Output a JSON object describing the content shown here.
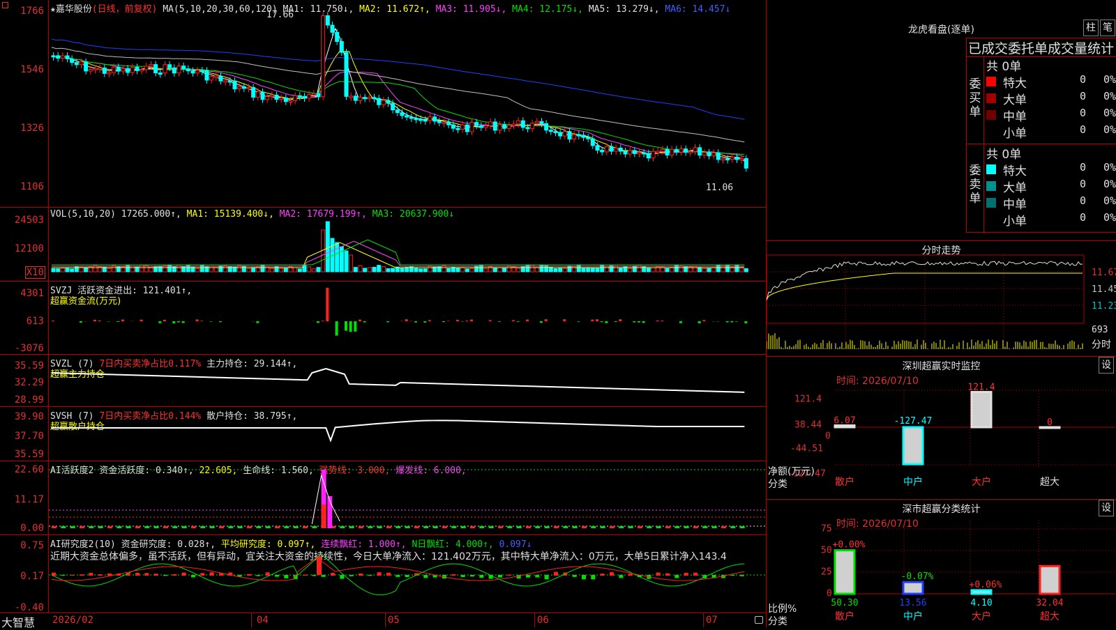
{
  "main": {
    "y_ticks": [
      "1766",
      "1546",
      "1326",
      "1106"
    ],
    "title_star": "★",
    "stock_name": "嘉华股份",
    "period": "(日线，前复权)",
    "ma_label": "MA(5,10,20,30,60,120)",
    "ma1": "MA1: 11.750↓,",
    "ma2": "MA2: 11.672↑,",
    "ma3": "MA3: 11.905↓,",
    "ma4": "MA4: 12.175↓,",
    "ma5": "MA5: 13.279↓,",
    "ma6": "MA6: 14.457↓",
    "high_mark": "17.66",
    "low_mark": "11.06"
  },
  "vol": {
    "y_ticks": [
      "24503",
      "12100"
    ],
    "unit": "X10",
    "label": "VOL(5,10,20)",
    "value": "17265.000↑,",
    "ma1": "MA1: 15139.400↓,",
    "ma2": "MA2: 17679.199↑,",
    "ma3": "MA3: 20637.900↓"
  },
  "svzj": {
    "y_ticks": [
      "4301",
      "613",
      "-3076"
    ],
    "line1": "SVZJ  活跃资金进出: 121.401↑,",
    "line2": "超赢资金流(万元)"
  },
  "svzl": {
    "y_ticks": [
      "35.59",
      "32.29",
      "28.99"
    ],
    "name": "SVZL (7)",
    "ratio": "7日内买卖净占比0.117%",
    "hold": "主力持仓: 29.144↑,",
    "line2": "超赢主力持仓"
  },
  "svsh": {
    "y_ticks": [
      "39.90",
      "37.70",
      "35.59"
    ],
    "name": "SVSH (7)",
    "ratio": "7日内买卖净占比0.144%",
    "hold": "散户持仓: 38.795↑,",
    "line2": "超赢散户持仓"
  },
  "ai1": {
    "y_ticks": [
      "22.60",
      "11.17",
      "0.00"
    ],
    "name": "AI活跃度2",
    "v1": "资金活跃度: 0.340↑,",
    "v2": "22.605,",
    "v3": "生命线: 1.560,",
    "v4": "强势线: 3.000,",
    "v5": "爆发线: 6.000,"
  },
  "ai2": {
    "y_ticks": [
      "0.75",
      "0.17",
      "-0.40"
    ],
    "name": "AI研究度2(10)",
    "v1": "资金研究度: 0.028↑,",
    "v2": "平均研究度: 0.097↑,",
    "v3": "连续飘红: 1.000↑,",
    "v4": "N日飘红: 4.000↑,",
    "v5": "0.097↓",
    "desc": "近期大资金总体偏多，虽不活跃，但有异动，宜关注大资金的持续性，今日大单净流入：121.402万元，其中特大单净流入：0万元，大单5日累计净入143.4"
  },
  "bottom": {
    "logo": "大智慧",
    "dates": [
      "2026/02",
      "04",
      "05",
      "06",
      "07"
    ]
  },
  "lhb": {
    "title": "龙虎看盘(逐单)",
    "btn1": "柱",
    "btn2": "笔",
    "header": "已成交委托单成交量统计",
    "buy_label": "委买单",
    "sell_label": "委卖单",
    "buy_total": "共 0单",
    "sell_total": "共 0单",
    "buy_rows": [
      {
        "label": "特大",
        "value": "0",
        "pct": "0%",
        "color": "#ff0000"
      },
      {
        "label": "大单",
        "value": "0",
        "pct": "0%",
        "color": "#a00000"
      },
      {
        "label": "中单",
        "value": "0",
        "pct": "0%",
        "color": "#700000"
      },
      {
        "label": "小单",
        "value": "0",
        "pct": "0%",
        "color": ""
      }
    ],
    "sell_rows": [
      {
        "label": "特大",
        "value": "0",
        "pct": "0%",
        "color": "#00ffff"
      },
      {
        "label": "大单",
        "value": "0",
        "pct": "0%",
        "color": "#009090"
      },
      {
        "label": "中单",
        "value": "0",
        "pct": "0%",
        "color": "#007070"
      },
      {
        "label": "小单",
        "value": "0",
        "pct": "0%",
        "color": ""
      }
    ]
  },
  "fenshi": {
    "title": "分时走势",
    "y_ticks": [
      "11.67",
      "11.45",
      "11.23"
    ],
    "vol_tick": "693",
    "unit": "分时"
  },
  "monitor": {
    "title": "深圳超赢实时监控",
    "btn": "设",
    "time": "时间: 2026/07/10",
    "ylabel": "净额(万元)",
    "xlabel": "分类",
    "y_ticks": [
      "121.4",
      "38.44",
      "0",
      "-44.51",
      "-127.47"
    ],
    "categories": [
      "散户",
      "中户",
      "大户",
      "超大"
    ],
    "values": [
      6.07,
      -127.47,
      121.4,
      0
    ],
    "value_labels": [
      "6.07",
      "-127.47",
      "121.4",
      "0"
    ]
  },
  "classify": {
    "title": "深市超赢分类统计",
    "btn": "设",
    "time": "时间: 2026/07/10",
    "ylabel": "比例%",
    "xlabel": "分类",
    "y_ticks": [
      "75",
      "50",
      "25",
      "0"
    ],
    "categories": [
      "散户",
      "中户",
      "大户",
      "超大"
    ],
    "values": [
      50.3,
      13.56,
      4.1,
      32.04
    ],
    "value_labels": [
      "50.30",
      "13.56",
      "4.10",
      "32.04"
    ],
    "change_labels": [
      "+0.00%",
      "-0.07%",
      "+0.06%",
      ""
    ]
  }
}
